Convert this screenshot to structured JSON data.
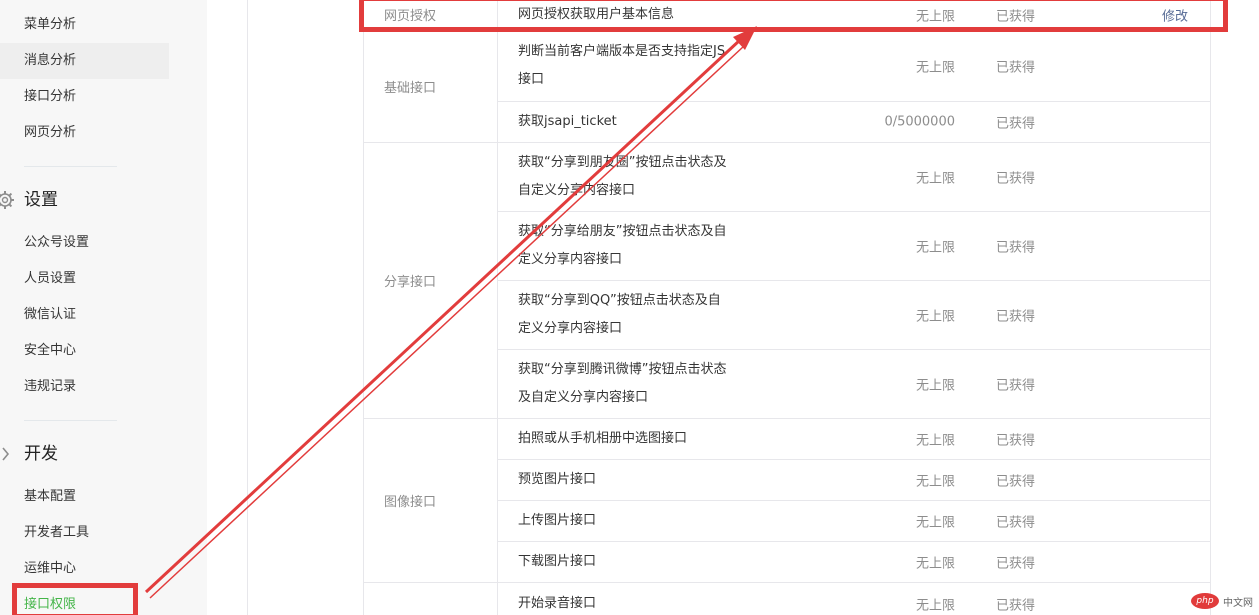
{
  "sidebar": {
    "top_items": [
      {
        "label": "菜单分析"
      },
      {
        "label": "消息分析"
      },
      {
        "label": "接口分析"
      },
      {
        "label": "网页分析"
      }
    ],
    "settings": {
      "title": "设置",
      "items": [
        {
          "label": "公众号设置"
        },
        {
          "label": "人员设置"
        },
        {
          "label": "微信认证"
        },
        {
          "label": "安全中心"
        },
        {
          "label": "违规记录"
        }
      ]
    },
    "dev": {
      "title": "开发",
      "items": [
        {
          "label": "基本配置"
        },
        {
          "label": "开发者工具"
        },
        {
          "label": "运维中心"
        },
        {
          "label": "接口权限"
        }
      ]
    }
  },
  "table": {
    "top_row": {
      "category": "网页授权",
      "name": "网页授权获取用户基本信息",
      "quota": "无上限",
      "status": "已获得",
      "action": "修改"
    },
    "groups": [
      {
        "category": "基础接口",
        "rows": [
          {
            "name": "判断当前客户端版本是否支持指定JS接口",
            "quota": "无上限",
            "status": "已获得"
          },
          {
            "name": "获取jsapi_ticket",
            "quota": "0/5000000",
            "status": "已获得"
          }
        ]
      },
      {
        "category": "分享接口",
        "rows": [
          {
            "name": "获取“分享到朋友圈”按钮点击状态及自定义分享内容接口",
            "quota": "无上限",
            "status": "已获得"
          },
          {
            "name": "获取“分享给朋友”按钮点击状态及自定义分享内容接口",
            "quota": "无上限",
            "status": "已获得"
          },
          {
            "name": "获取“分享到QQ”按钮点击状态及自定义分享内容接口",
            "quota": "无上限",
            "status": "已获得"
          },
          {
            "name": "获取“分享到腾讯微博”按钮点击状态及自定义分享内容接口",
            "quota": "无上限",
            "status": "已获得"
          }
        ]
      },
      {
        "category": "图像接口",
        "rows": [
          {
            "name": "拍照或从手机相册中选图接口",
            "quota": "无上限",
            "status": "已获得"
          },
          {
            "name": "预览图片接口",
            "quota": "无上限",
            "status": "已获得"
          },
          {
            "name": "上传图片接口",
            "quota": "无上限",
            "status": "已获得"
          },
          {
            "name": "下载图片接口",
            "quota": "无上限",
            "status": "已获得"
          }
        ]
      },
      {
        "category": "",
        "rows": [
          {
            "name": "开始录音接口",
            "quota": "无上限",
            "status": "已获得"
          }
        ]
      }
    ]
  },
  "watermark": {
    "logo": "php",
    "text": "中文网"
  },
  "colors": {
    "annotation_red": "#e23c3c",
    "active_green": "#44b549",
    "link_blue": "#576b95"
  }
}
